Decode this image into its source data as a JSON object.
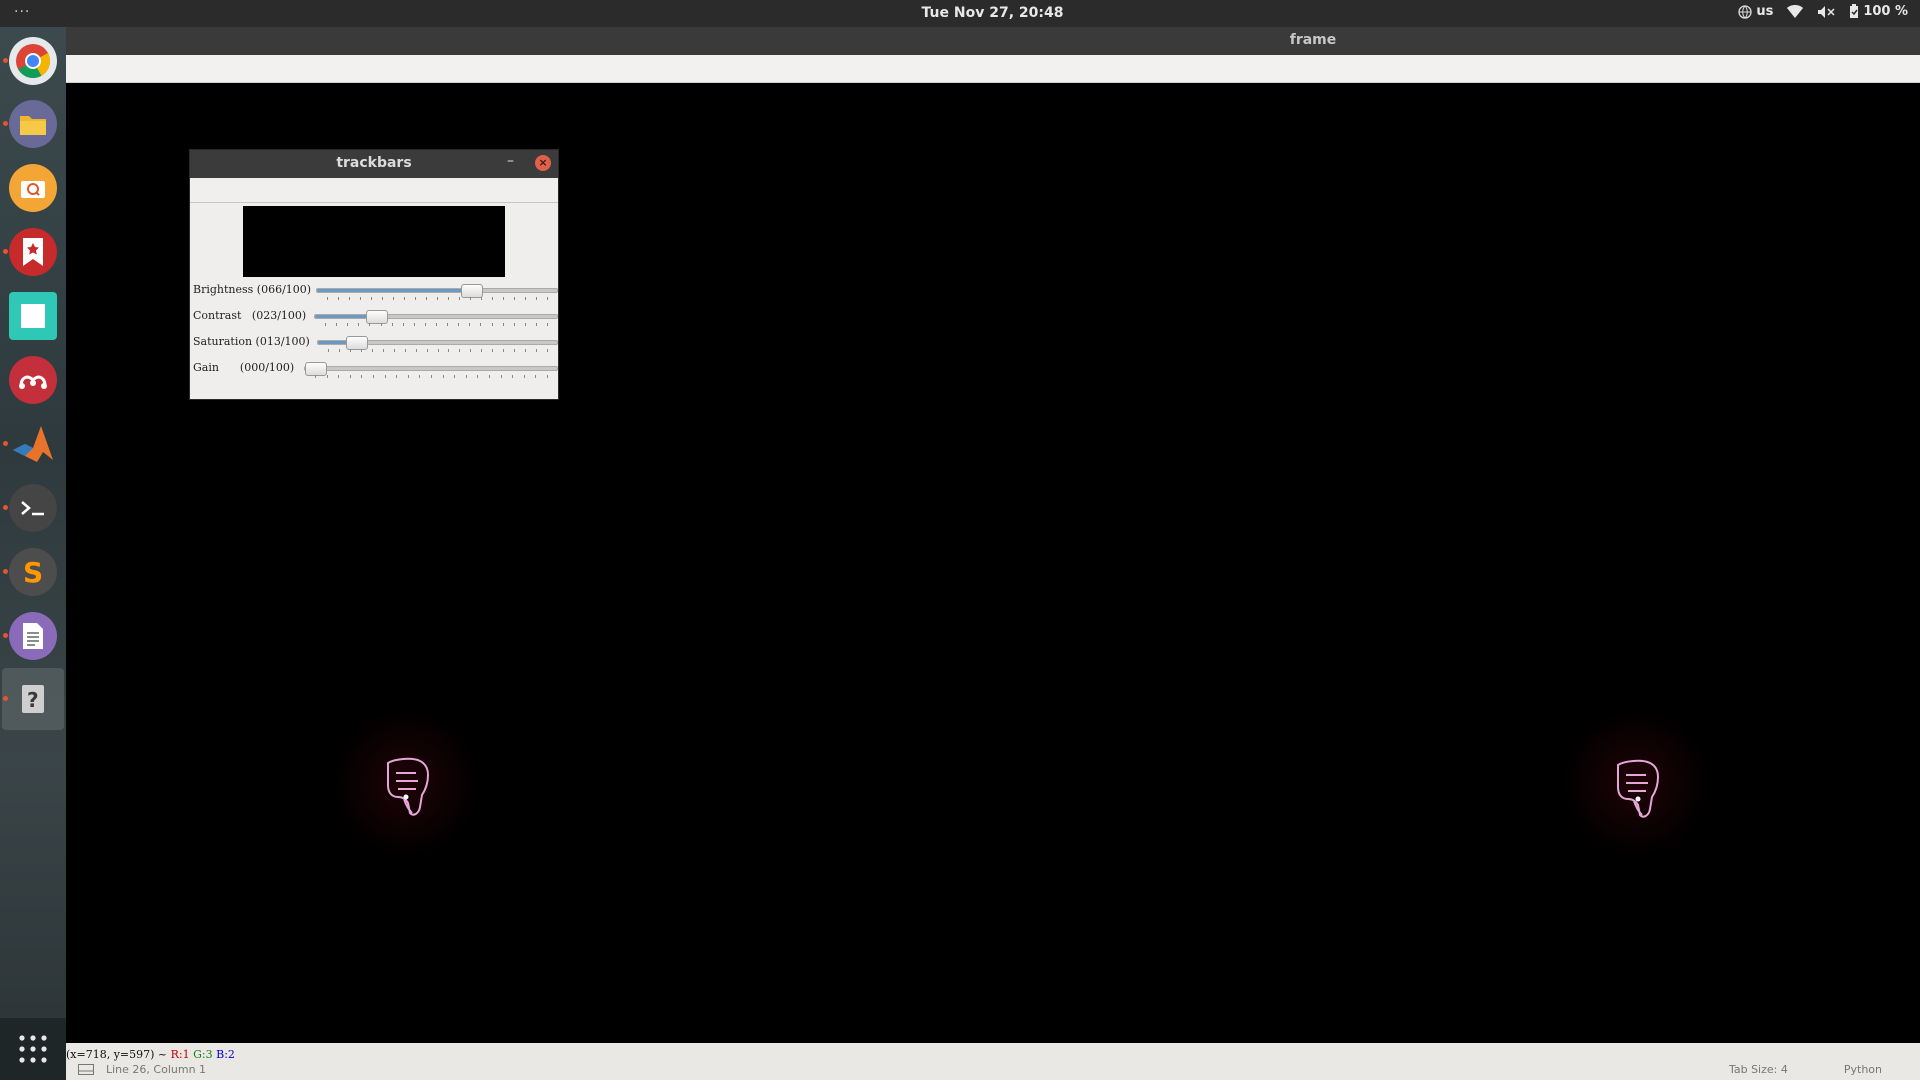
{
  "topbar": {
    "menu_dots": "···",
    "clock": "Tue Nov 27, 20:48",
    "keyboard_layout": "us",
    "battery": "100 %"
  },
  "dock": {
    "items": [
      {
        "name": "chrome",
        "color": "#dfe3e6",
        "running": true
      },
      {
        "name": "files",
        "color": "#6c6c9c",
        "running": true
      },
      {
        "name": "screenshot",
        "color": "#f0a030",
        "running": false
      },
      {
        "name": "bookmark-app",
        "color": "#c22b2b",
        "running": true
      },
      {
        "name": "whiteboard",
        "color": "#3ad0c0",
        "running": false
      },
      {
        "name": "mendeley",
        "color": "#c0303a",
        "running": false
      },
      {
        "name": "matlab",
        "color": "#2a74b8",
        "running": true
      },
      {
        "name": "terminal",
        "color": "#4a4a4a",
        "running": true
      },
      {
        "name": "sublime-text",
        "color": "#555555",
        "running": true
      },
      {
        "name": "text-editor",
        "color": "#8a6fb8",
        "running": true
      },
      {
        "name": "unknown-app",
        "color": "#4a4f52",
        "running": true
      }
    ]
  },
  "frame_window": {
    "title": "frame",
    "pixel_info": {
      "coords": "(x=718, y=597) ~ ",
      "r": "R:1",
      "g": "G:3",
      "b": "B:2"
    },
    "editor_status": {
      "position": "Line 26, Column 1",
      "tab_size": "Tab Size: 4",
      "language": "Python"
    }
  },
  "trackbars": {
    "title": "trackbars",
    "minimize": "–",
    "close": "×",
    "sliders": [
      {
        "label": "Brightness (066/100)",
        "value": 66
      },
      {
        "label": "Contrast   (023/100)",
        "value": 23
      },
      {
        "label": "Saturation (013/100)",
        "value": 13
      },
      {
        "label": "Gain      (000/100)",
        "value": 0
      }
    ]
  }
}
